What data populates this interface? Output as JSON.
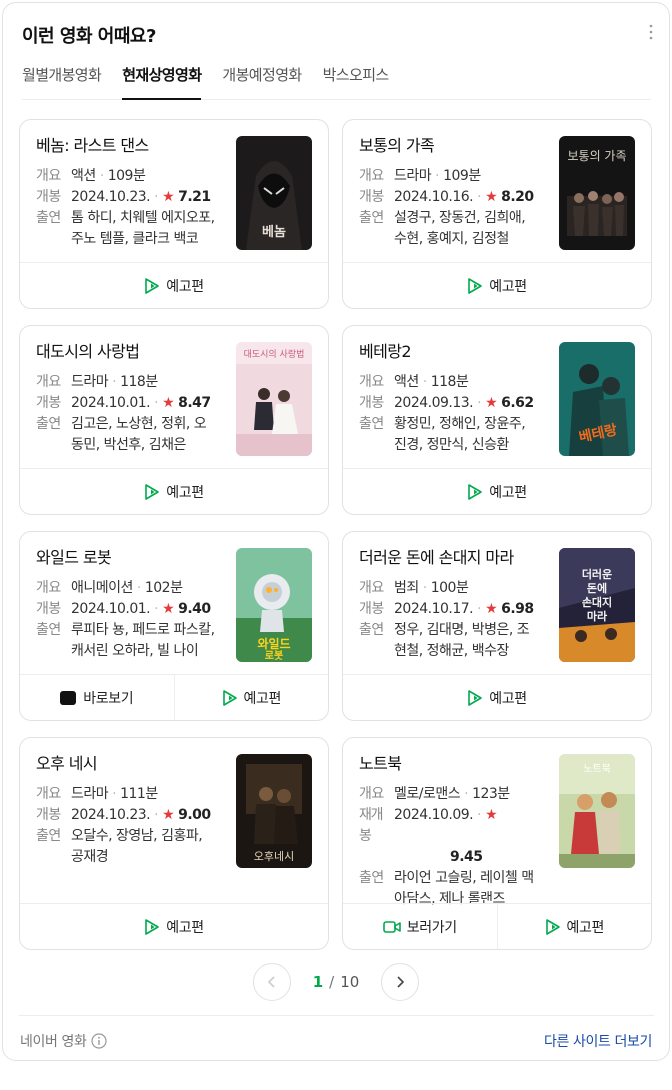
{
  "header": {
    "title": "이런 영화 어때요?",
    "more_icon": "more-vertical-icon"
  },
  "tabs": [
    {
      "label": "월별개봉영화",
      "active": false
    },
    {
      "label": "현재상영영화",
      "active": true
    },
    {
      "label": "개봉예정영화",
      "active": false
    },
    {
      "label": "박스오피스",
      "active": false
    }
  ],
  "labels": {
    "summary": "개요",
    "release": "개봉",
    "rerelease": "재개봉",
    "cast": "출연"
  },
  "movies": [
    {
      "title": "베놈: 라스트 댄스",
      "genre": "액션",
      "runtime": "109분",
      "date": "2024.10.23.",
      "rating": "7.21",
      "cast": "톰 하디, 치웨텔 에지오포, 주노 템플, 클라크 백코",
      "buttons": [
        "예고편"
      ]
    },
    {
      "title": "보통의 가족",
      "genre": "드라마",
      "runtime": "109분",
      "date": "2024.10.16.",
      "rating": "8.20",
      "cast": "설경구, 장동건, 김희애, 수현, 홍예지, 김정철",
      "buttons": [
        "예고편"
      ]
    },
    {
      "title": "대도시의 사랑법",
      "genre": "드라마",
      "runtime": "118분",
      "date": "2024.10.01.",
      "rating": "8.47",
      "cast": "김고은, 노상현, 정휘, 오동민, 박선후, 김채은",
      "buttons": [
        "예고편"
      ]
    },
    {
      "title": "베테랑2",
      "genre": "액션",
      "runtime": "118분",
      "date": "2024.09.13.",
      "rating": "6.62",
      "cast": "황정민, 정해인, 장윤주, 진경, 정만식, 신승환",
      "buttons": [
        "예고편"
      ]
    },
    {
      "title": "와일드 로봇",
      "genre": "애니메이션",
      "runtime": "102분",
      "date": "2024.10.01.",
      "rating": "9.40",
      "cast": "루피타 뇽, 페드로 파스칼, 캐서린 오하라, 빌 나이",
      "buttons": [
        "바로보기",
        "예고편"
      ]
    },
    {
      "title": "더러운 돈에 손대지 마라",
      "genre": "범죄",
      "runtime": "100분",
      "date": "2024.10.17.",
      "rating": "6.98",
      "cast": "정우, 김대명, 박병은, 조현철, 정해균, 백수장",
      "buttons": [
        "예고편"
      ]
    },
    {
      "title": "오후 네시",
      "genre": "드라마",
      "runtime": "111분",
      "date": "2024.10.23.",
      "rating": "9.00",
      "cast": "오달수, 장영남, 김홍파, 공재경",
      "buttons": [
        "예고편"
      ]
    },
    {
      "title": "노트북",
      "genre": "멜로/로맨스",
      "runtime": "123분",
      "date": "2024.10.09.",
      "rating": "9.45",
      "cast": "라이언 고슬링, 레이첼 맥아담스, 제나 롤랜즈",
      "buttons": [
        "보러가기",
        "예고편"
      ],
      "rerelease": true
    }
  ],
  "pagination": {
    "current": "1",
    "separator": "/",
    "total": "10"
  },
  "footer": {
    "source": "네이버 영화",
    "more_link": "다른 사이트 더보기"
  },
  "colors": {
    "accent": "#03a94d",
    "star": "#e33b3b",
    "link": "#1a4aa8"
  }
}
